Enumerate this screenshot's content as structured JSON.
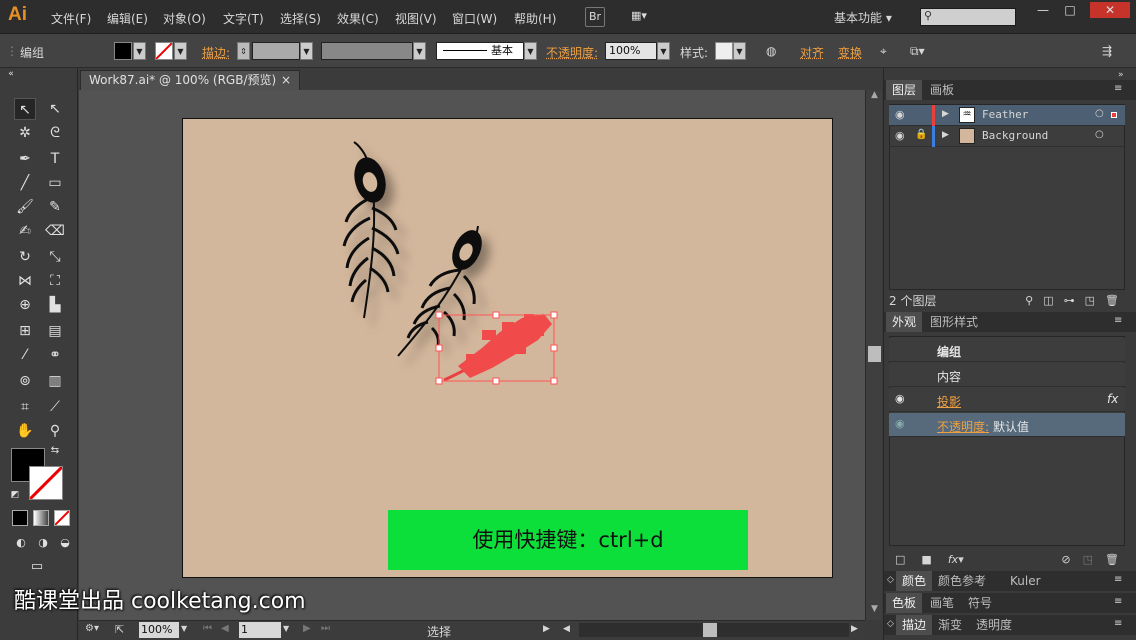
{
  "app": {
    "logo": "Ai",
    "menu": [
      "文件(F)",
      "编辑(E)",
      "对象(O)",
      "文字(T)",
      "选择(S)",
      "效果(C)",
      "视图(V)",
      "窗口(W)",
      "帮助(H)"
    ],
    "bridge_label": "Br",
    "workspace": "基本功能",
    "window_controls": [
      "—",
      "□",
      "✕"
    ]
  },
  "control": {
    "selection_type": "编组",
    "stroke_label": "描边",
    "stroke_style": "基本",
    "opacity_label": "不透明度",
    "opacity_value": "100%",
    "style_label": "样式",
    "align_label": "对齐",
    "transform_label": "变换"
  },
  "document": {
    "tab_title": "Work87.ai* @ 100% (RGB/预览)",
    "close_glyph": "×",
    "banner_text": "使用快捷键：ctrl+d"
  },
  "status": {
    "zoom": "100%",
    "artboard_number": "1",
    "tool_name": "选择"
  },
  "layers_panel": {
    "tabs": [
      "图层",
      "画板"
    ],
    "layers": [
      {
        "name": "Feather",
        "color": "#e8413c"
      },
      {
        "name": "Background",
        "color": "#3b7de0"
      }
    ],
    "count_label": "2 个图层"
  },
  "appearance_panel": {
    "tabs": [
      "外观",
      "图形样式"
    ],
    "title": "编组",
    "contents": "内容",
    "effect": "投影",
    "fx": "fx",
    "opacity_label": "不透明度:",
    "opacity_value": "默认值"
  },
  "collapsed_panels": [
    [
      "颜色",
      "颜色参考",
      "Kuler"
    ],
    [
      "色板",
      "画笔",
      "符号"
    ],
    [
      "描边",
      "渐变",
      "透明度"
    ]
  ],
  "watermark": "酷课堂出品 coolketang.com"
}
